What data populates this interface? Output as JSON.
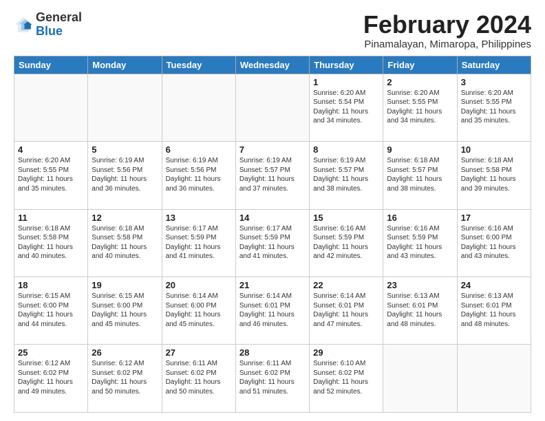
{
  "header": {
    "logo_general": "General",
    "logo_blue": "Blue",
    "title": "February 2024",
    "subtitle": "Pinamalayan, Mimaropa, Philippines"
  },
  "days_of_week": [
    "Sunday",
    "Monday",
    "Tuesday",
    "Wednesday",
    "Thursday",
    "Friday",
    "Saturday"
  ],
  "weeks": [
    [
      {
        "day": "",
        "info": ""
      },
      {
        "day": "",
        "info": ""
      },
      {
        "day": "",
        "info": ""
      },
      {
        "day": "",
        "info": ""
      },
      {
        "day": "1",
        "info": "Sunrise: 6:20 AM\nSunset: 5:54 PM\nDaylight: 11 hours and 34 minutes."
      },
      {
        "day": "2",
        "info": "Sunrise: 6:20 AM\nSunset: 5:55 PM\nDaylight: 11 hours and 34 minutes."
      },
      {
        "day": "3",
        "info": "Sunrise: 6:20 AM\nSunset: 5:55 PM\nDaylight: 11 hours and 35 minutes."
      }
    ],
    [
      {
        "day": "4",
        "info": "Sunrise: 6:20 AM\nSunset: 5:55 PM\nDaylight: 11 hours and 35 minutes."
      },
      {
        "day": "5",
        "info": "Sunrise: 6:19 AM\nSunset: 5:56 PM\nDaylight: 11 hours and 36 minutes."
      },
      {
        "day": "6",
        "info": "Sunrise: 6:19 AM\nSunset: 5:56 PM\nDaylight: 11 hours and 36 minutes."
      },
      {
        "day": "7",
        "info": "Sunrise: 6:19 AM\nSunset: 5:57 PM\nDaylight: 11 hours and 37 minutes."
      },
      {
        "day": "8",
        "info": "Sunrise: 6:19 AM\nSunset: 5:57 PM\nDaylight: 11 hours and 38 minutes."
      },
      {
        "day": "9",
        "info": "Sunrise: 6:18 AM\nSunset: 5:57 PM\nDaylight: 11 hours and 38 minutes."
      },
      {
        "day": "10",
        "info": "Sunrise: 6:18 AM\nSunset: 5:58 PM\nDaylight: 11 hours and 39 minutes."
      }
    ],
    [
      {
        "day": "11",
        "info": "Sunrise: 6:18 AM\nSunset: 5:58 PM\nDaylight: 11 hours and 40 minutes."
      },
      {
        "day": "12",
        "info": "Sunrise: 6:18 AM\nSunset: 5:58 PM\nDaylight: 11 hours and 40 minutes."
      },
      {
        "day": "13",
        "info": "Sunrise: 6:17 AM\nSunset: 5:59 PM\nDaylight: 11 hours and 41 minutes."
      },
      {
        "day": "14",
        "info": "Sunrise: 6:17 AM\nSunset: 5:59 PM\nDaylight: 11 hours and 41 minutes."
      },
      {
        "day": "15",
        "info": "Sunrise: 6:16 AM\nSunset: 5:59 PM\nDaylight: 11 hours and 42 minutes."
      },
      {
        "day": "16",
        "info": "Sunrise: 6:16 AM\nSunset: 5:59 PM\nDaylight: 11 hours and 43 minutes."
      },
      {
        "day": "17",
        "info": "Sunrise: 6:16 AM\nSunset: 6:00 PM\nDaylight: 11 hours and 43 minutes."
      }
    ],
    [
      {
        "day": "18",
        "info": "Sunrise: 6:15 AM\nSunset: 6:00 PM\nDaylight: 11 hours and 44 minutes."
      },
      {
        "day": "19",
        "info": "Sunrise: 6:15 AM\nSunset: 6:00 PM\nDaylight: 11 hours and 45 minutes."
      },
      {
        "day": "20",
        "info": "Sunrise: 6:14 AM\nSunset: 6:00 PM\nDaylight: 11 hours and 45 minutes."
      },
      {
        "day": "21",
        "info": "Sunrise: 6:14 AM\nSunset: 6:01 PM\nDaylight: 11 hours and 46 minutes."
      },
      {
        "day": "22",
        "info": "Sunrise: 6:14 AM\nSunset: 6:01 PM\nDaylight: 11 hours and 47 minutes."
      },
      {
        "day": "23",
        "info": "Sunrise: 6:13 AM\nSunset: 6:01 PM\nDaylight: 11 hours and 48 minutes."
      },
      {
        "day": "24",
        "info": "Sunrise: 6:13 AM\nSunset: 6:01 PM\nDaylight: 11 hours and 48 minutes."
      }
    ],
    [
      {
        "day": "25",
        "info": "Sunrise: 6:12 AM\nSunset: 6:02 PM\nDaylight: 11 hours and 49 minutes."
      },
      {
        "day": "26",
        "info": "Sunrise: 6:12 AM\nSunset: 6:02 PM\nDaylight: 11 hours and 50 minutes."
      },
      {
        "day": "27",
        "info": "Sunrise: 6:11 AM\nSunset: 6:02 PM\nDaylight: 11 hours and 50 minutes."
      },
      {
        "day": "28",
        "info": "Sunrise: 6:11 AM\nSunset: 6:02 PM\nDaylight: 11 hours and 51 minutes."
      },
      {
        "day": "29",
        "info": "Sunrise: 6:10 AM\nSunset: 6:02 PM\nDaylight: 11 hours and 52 minutes."
      },
      {
        "day": "",
        "info": ""
      },
      {
        "day": "",
        "info": ""
      }
    ]
  ]
}
